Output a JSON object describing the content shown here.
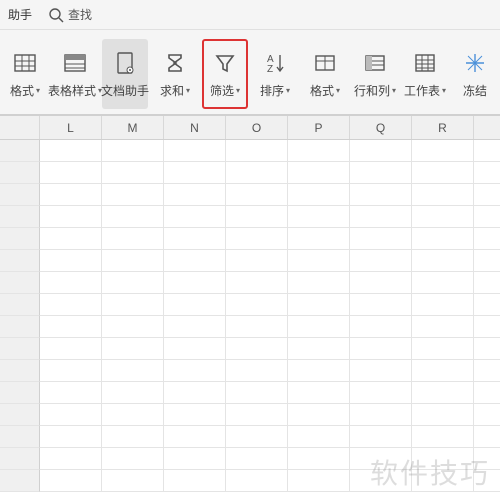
{
  "topbar": {
    "assistant_label": "助手",
    "search_label": "查找"
  },
  "ribbon": {
    "items": [
      {
        "label": "格式",
        "has_dd": true,
        "icon": "cell-format-icon"
      },
      {
        "label": "表格样式",
        "has_dd": true,
        "icon": "table-style-icon"
      },
      {
        "label": "文档助手",
        "has_dd": false,
        "icon": "doc-assistant-icon",
        "active": true
      },
      {
        "label": "求和",
        "has_dd": true,
        "icon": "sum-icon"
      },
      {
        "label": "筛选",
        "has_dd": true,
        "icon": "filter-icon",
        "highlight": true
      },
      {
        "label": "排序",
        "has_dd": true,
        "icon": "sort-icon"
      },
      {
        "label": "格式",
        "has_dd": true,
        "icon": "format-icon"
      },
      {
        "label": "行和列",
        "has_dd": true,
        "icon": "rowcol-icon"
      },
      {
        "label": "工作表",
        "has_dd": true,
        "icon": "worksheet-icon"
      },
      {
        "label": "冻结",
        "has_dd": false,
        "icon": "freeze-icon"
      }
    ]
  },
  "grid": {
    "columns": [
      "L",
      "M",
      "N",
      "O",
      "P",
      "Q",
      "R"
    ],
    "row_count": 16
  },
  "watermark": "软件技巧"
}
